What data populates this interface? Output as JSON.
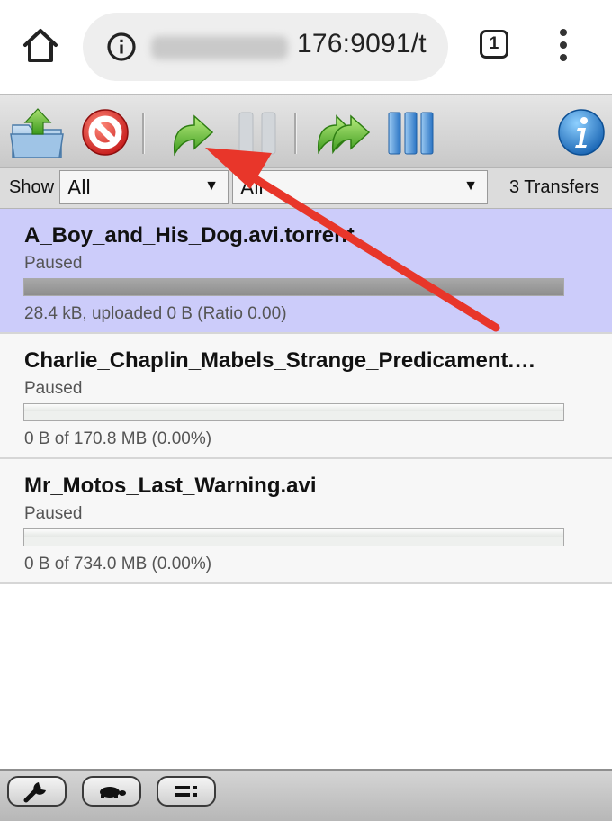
{
  "browser": {
    "url_visible": "176:9091/t",
    "tab_count": "1",
    "icons": [
      "home-icon",
      "info-icon",
      "tabs-icon",
      "more-vert-icon"
    ]
  },
  "toolbar": {
    "buttons": [
      "open-torrent-icon",
      "remove-torrent-icon",
      "resume-icon",
      "pause-icon",
      "resume-all-icon",
      "pause-all-icon",
      "inspector-icon"
    ]
  },
  "filter": {
    "show_label": "Show",
    "status_select": "All",
    "tracker_select": "All",
    "transfers_count": "3 Transfers"
  },
  "torrents": [
    {
      "name": "A_Boy_and_His_Dog.avi.torrent",
      "status": "Paused",
      "progress_text": "28.4 kB, uploaded 0 B (Ratio 0.00)",
      "percent_done": 100,
      "selected": true
    },
    {
      "name": "Charlie_Chaplin_Mabels_Strange_Predicament.…",
      "status": "Paused",
      "progress_text": "0 B of 170.8 MB (0.00%)",
      "percent_done": 0,
      "selected": false
    },
    {
      "name": "Mr_Motos_Last_Warning.avi",
      "status": "Paused",
      "progress_text": "0 B of 734.0 MB (0.00%)",
      "percent_done": 0,
      "selected": false
    }
  ],
  "bottom_bar": {
    "buttons": [
      "settings-wrench-icon",
      "turtle-speed-icon",
      "compact-view-icon"
    ]
  },
  "colors": {
    "selected_row": "#ccccfa",
    "annotation_arrow": "#e8362a",
    "toolbar_green": "#4cae2c",
    "toolbar_blue": "#2f7fd0",
    "remove_red": "#d42a2a"
  }
}
